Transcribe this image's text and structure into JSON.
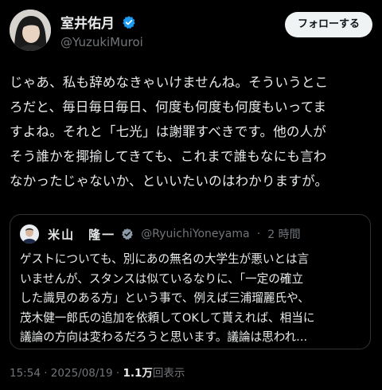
{
  "author": {
    "display_name": "室井佑月",
    "handle": "@YuzukiMuroi",
    "verified_icon": "verified-badge-icon"
  },
  "follow_button": {
    "label": "フォローする"
  },
  "tweet": {
    "lines": [
      "じゃあ、私も辞めなきゃいけませんね。そういうとこ",
      "ろだと、毎日毎日毎日、何度も何度も何度もいってま",
      "すよね。それと「七光」は謝罪すべきです。他の人が",
      "そう誰かを揶揄してきても、これまで誰もなにも言わ",
      "なかったじゃないか、といいたいのはわかりますが。"
    ]
  },
  "quoted_tweet": {
    "display_name": "米山　隆一",
    "handle": "@RyuichiYoneyama",
    "separator": "·",
    "time": "2 時間",
    "lines": [
      "ゲストについても、別にあの無名の大学生が悪いとは言",
      "いませんが、スタンスは似ているなりに、「一定の確立",
      "した識見のある方」という事で、例えば三浦瑠麗氏や、",
      "茂木健一郎氏の追加を依頼してOKして貰えれば、相当に",
      "議論の方向は変わるだろうと思います。議論は思われ..."
    ]
  },
  "meta": {
    "time": "15:54",
    "separator": "·",
    "date": "2025/08/19",
    "views_count": "1.1万",
    "views_label": "回表示"
  },
  "colors": {
    "background": "#000000",
    "text": "#e7e9ea",
    "secondary_text": "#71767b",
    "verified": "#1d9bf0",
    "border": "#2f3336"
  }
}
